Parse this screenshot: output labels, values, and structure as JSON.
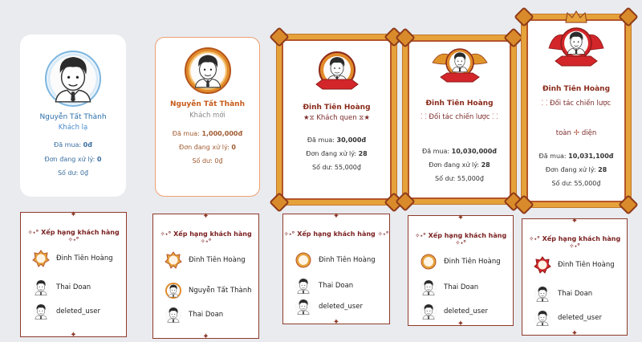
{
  "profile_cards": [
    {
      "name": "Nguyễn Tất Thành",
      "rank": "Khách lạ",
      "bought_label": "Đã mua:",
      "bought": "0đ",
      "pending_label": "Đơn đang xử lý:",
      "pending": "0",
      "balance_label": "Số dư:",
      "balance": "0₫"
    },
    {
      "name": "Nguyễn Tất Thành",
      "rank": "Khách mới",
      "bought_label": "Đã mua:",
      "bought": "1,000,000đ",
      "pending_label": "Đơn đang xử lý:",
      "pending": "0",
      "balance_label": "Số dư:",
      "balance": "0₫"
    },
    {
      "name": "Đinh Tiên Hoàng",
      "rank": "Khách quen",
      "rank_prefix": "★⧖",
      "rank_suffix": "⧖★",
      "bought_label": "Đã mua:",
      "bought": "30,000đ",
      "pending_label": "Đơn đang xử lý:",
      "pending": "28",
      "balance_label": "Số dư:",
      "balance": "55,000₫"
    },
    {
      "name": "Đinh Tiên Hoàng",
      "rank": "Đối tác chiến lược",
      "rank_prefix": "⸬",
      "rank_suffix": "⸬",
      "bought_label": "Đã mua:",
      "bought": "10,030,000đ",
      "pending_label": "Đơn đang xử lý:",
      "pending": "28",
      "balance_label": "Số dư:",
      "balance": "55,000₫"
    },
    {
      "name": "Đinh Tiên Hoàng",
      "rank": "Đối tác chiến lược",
      "rank_prefix": "⸬",
      "rank_line2_a": "toàn",
      "rank_line2_b": "diện",
      "bought_label": "Đã mua:",
      "bought": "10,031,100đ",
      "pending_label": "Đơn đang xử lý:",
      "pending": "28",
      "balance_label": "Số dư:",
      "balance": "55,000₫"
    }
  ],
  "leaderboards": [
    {
      "title": "✧˖° Xếp hạng khách hàng ✧˖°",
      "entries": [
        "Đinh Tiên Hoàng",
        "Thai Doan",
        "deleted_user"
      ]
    },
    {
      "title": "✧˖° Xếp hạng khách hàng ✧˖°",
      "entries": [
        "Đinh Tiên Hoàng",
        "Nguyễn Tất Thành",
        "Thai Doan"
      ]
    },
    {
      "title": "✧˖° Xếp hạng khách hàng ✧˖°",
      "entries": [
        "Đinh Tiên Hoàng",
        "Thai Doan",
        "deleted_user"
      ]
    },
    {
      "title": "✧˖° Xếp hạng khách hàng ✧˖°",
      "entries": [
        "Đinh Tiên Hoàng",
        "Thai Doan",
        "deleted_user"
      ]
    },
    {
      "title": "✧˖° Xếp hạng khách hàng ✧˖°",
      "entries": [
        "Đinh Tiên Hoàng",
        "Thai Doan",
        "deleted_user"
      ]
    }
  ],
  "colors": {
    "gold": "#e5a23a",
    "maroon": "#8e3a2a",
    "blue": "#2a6ea8",
    "orange": "#c75a1a"
  }
}
